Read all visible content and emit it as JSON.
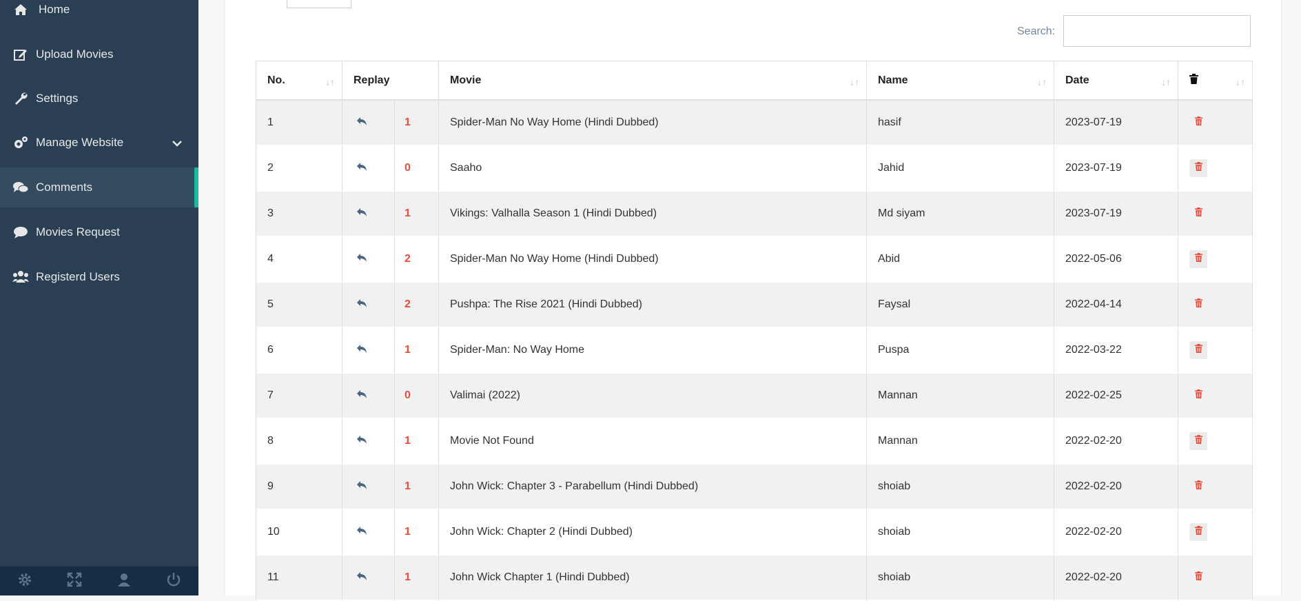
{
  "sidebar": {
    "items": [
      {
        "label": "Home",
        "icon": "home-icon"
      },
      {
        "label": "Upload Movies",
        "icon": "edit-icon"
      },
      {
        "label": "Settings",
        "icon": "wrench-icon"
      },
      {
        "label": "Manage Website",
        "icon": "gears-icon"
      },
      {
        "label": "Comments",
        "icon": "comments-icon"
      },
      {
        "label": "Movies Request",
        "icon": "comment-icon"
      },
      {
        "label": "Registerd Users",
        "icon": "users-icon"
      }
    ],
    "active": "Comments",
    "footer_icons": [
      "gear-icon",
      "fullscreen-icon",
      "user-icon",
      "power-icon"
    ]
  },
  "search": {
    "label": "Search:",
    "value": ""
  },
  "table": {
    "headers": {
      "no": "No.",
      "replay": "Replay",
      "movie": "Movie",
      "name": "Name",
      "date": "Date",
      "delete": "trash-icon"
    },
    "rows": [
      {
        "no": "1",
        "replies": "1",
        "movie": "Spider-Man No Way Home (Hindi Dubbed)",
        "name": "hasif",
        "date": "2023-07-19"
      },
      {
        "no": "2",
        "replies": "0",
        "movie": "Saaho",
        "name": "Jahid",
        "date": "2023-07-19"
      },
      {
        "no": "3",
        "replies": "1",
        "movie": "Vikings: Valhalla Season 1 (Hindi Dubbed)",
        "name": "Md siyam",
        "date": "2023-07-19"
      },
      {
        "no": "4",
        "replies": "2",
        "movie": "Spider-Man No Way Home (Hindi Dubbed)",
        "name": "Abid",
        "date": "2022-05-06"
      },
      {
        "no": "5",
        "replies": "2",
        "movie": "Pushpa: The Rise 2021 (Hindi Dubbed)",
        "name": "Faysal",
        "date": "2022-04-14"
      },
      {
        "no": "6",
        "replies": "1",
        "movie": "Spider-Man: No Way Home",
        "name": "Puspa",
        "date": "2022-03-22"
      },
      {
        "no": "7",
        "replies": "0",
        "movie": "Valimai (2022)",
        "name": "Mannan",
        "date": "2022-02-25"
      },
      {
        "no": "8",
        "replies": "1",
        "movie": "Movie Not Found",
        "name": "Mannan",
        "date": "2022-02-20"
      },
      {
        "no": "9",
        "replies": "1",
        "movie": "John Wick: Chapter 3 - Parabellum (Hindi Dubbed)",
        "name": "shoiab",
        "date": "2022-02-20"
      },
      {
        "no": "10",
        "replies": "1",
        "movie": "John Wick: Chapter 2 (Hindi Dubbed)",
        "name": "shoiab",
        "date": "2022-02-20"
      },
      {
        "no": "11",
        "replies": "1",
        "movie": "John Wick Chapter 1 (Hindi Dubbed)",
        "name": "shoiab",
        "date": "2022-02-20"
      }
    ]
  },
  "colors": {
    "sidebar": "#2a3f54",
    "accent": "#1abb9c",
    "count": "#e74c3c",
    "delete": "#e74c3c"
  }
}
